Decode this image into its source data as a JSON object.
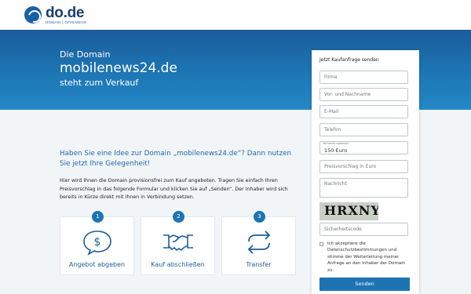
{
  "header": {
    "logo_name": "do.de",
    "logo_tagline": "DOMAIN | OFFENSIVE"
  },
  "hero": {
    "subtitle": "Die Domain",
    "domain": "mobilenews24.de",
    "subtitle2": "steht zum Verkauf"
  },
  "main": {
    "headline": "Haben Sie eine Idee zur Domain „mobilenews24.de“? Dann nutzen Sie jetzt Ihre Gelegenheit!",
    "description": "Hier wird Ihnen die Domain provisionsfrei zum Kauf angeboten. Tragen Sie einfach Ihren Preisvorschlag in das folgende Formular und klicken Sie auf „Senden“. Der Inhaber wird sich bereits in Kürze direkt mit Ihnen in Verbindung setzen.",
    "steps": [
      {
        "number": "1",
        "label": "Angebot abgeben",
        "icon": "dollar-speech-bubble-icon"
      },
      {
        "number": "2",
        "label": "Kauf abschließen",
        "icon": "handshake-icon"
      },
      {
        "number": "3",
        "label": "Transfer",
        "icon": "transfer-arrows-icon"
      }
    ]
  },
  "form": {
    "title": "Jetzt Kaufanfrage senden",
    "firma_placeholder": "Firma",
    "name_placeholder": "Vor- und Nachname",
    "email_placeholder": "E-Mail",
    "telefon_placeholder": "Telefon",
    "price_label": "Verhandlungsbasis",
    "price_value": "150 Euro",
    "price_offer_placeholder": "Preisvorschlag in Euro",
    "message_placeholder": "Nachricht",
    "captcha_text": "HRXNY",
    "security_placeholder": "Sicherheitscode",
    "consent_text": "Ich akzeptiere die Datenschutzbestimmungen und stimme der Weiterleitung meiner Anfrage an den Inhaber der Domain zu.",
    "send_label": "Senden"
  },
  "colors": {
    "brand_blue": "#1d74b3",
    "headline_blue": "#2169ad"
  }
}
